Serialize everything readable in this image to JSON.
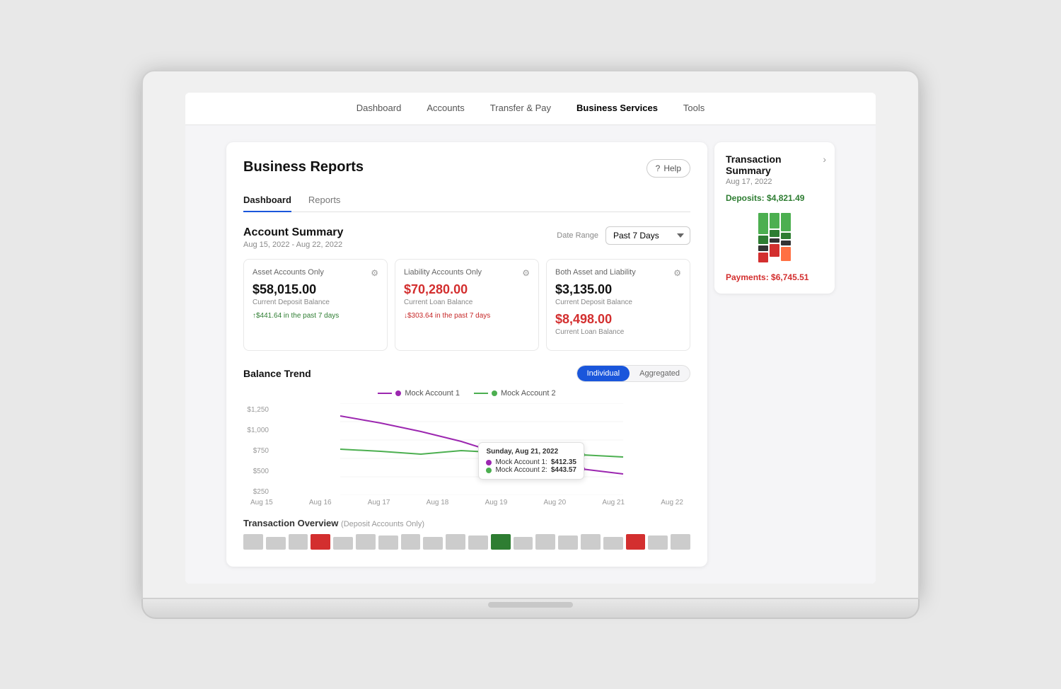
{
  "nav": {
    "items": [
      {
        "id": "dashboard",
        "label": "Dashboard",
        "active": false
      },
      {
        "id": "accounts",
        "label": "Accounts",
        "active": false
      },
      {
        "id": "transfer-pay",
        "label": "Transfer & Pay",
        "active": false
      },
      {
        "id": "business-services",
        "label": "Business Services",
        "active": true
      },
      {
        "id": "tools",
        "label": "Tools",
        "active": false
      }
    ]
  },
  "page": {
    "title": "Business Reports",
    "help_label": "Help"
  },
  "tabs": [
    {
      "id": "dashboard",
      "label": "Dashboard",
      "active": true
    },
    {
      "id": "reports",
      "label": "Reports",
      "active": false
    }
  ],
  "account_summary": {
    "title": "Account Summary",
    "date_range_text": "Aug 15, 2022 - Aug 22, 2022",
    "date_range_label": "Date Range",
    "date_range_value": "Past 7 Days",
    "cards": [
      {
        "title": "Asset Accounts Only",
        "amount": "$58,015.00",
        "amount_red": false,
        "balance_label": "Current Deposit Balance",
        "change": "↑$441.64 in the past 7 days",
        "change_type": "up"
      },
      {
        "title": "Liability Accounts Only",
        "amount": "$70,280.00",
        "amount_red": true,
        "balance_label": "Current Loan Balance",
        "change": "↓$303.64 in the past 7 days",
        "change_type": "down"
      },
      {
        "title": "Both Asset and Liability",
        "amount": "$3,135.00",
        "amount_red": false,
        "balance_label": "Current Deposit Balance",
        "amount2": "$8,498.00",
        "amount2_red": true,
        "balance_label2": "Current Loan Balance",
        "change": "",
        "change_type": ""
      }
    ]
  },
  "balance_trend": {
    "title": "Balance Trend",
    "toggle": {
      "individual": "Individual",
      "aggregated": "Aggregated",
      "active": "individual"
    },
    "legend": [
      {
        "label": "Mock Account 1",
        "color": "#9c27b0"
      },
      {
        "label": "Mock Account 2",
        "color": "#4caf50"
      }
    ],
    "y_labels": [
      "$1,250",
      "$1,000",
      "$750",
      "$500",
      "$250"
    ],
    "x_labels": [
      "Aug 15",
      "Aug 16",
      "Aug 17",
      "Aug 18",
      "Aug 19",
      "Aug 20",
      "Aug 21",
      "Aug 22"
    ],
    "tooltip": {
      "date": "Sunday, Aug 21, 2022",
      "account1_label": "Mock Account 1:",
      "account1_value": "$412.35",
      "account2_label": "Mock Account 2:",
      "account2_value": "$443.57"
    }
  },
  "transaction_overview": {
    "title": "Transaction Overview",
    "subtitle": "(Deposit Accounts Only)"
  },
  "transaction_summary": {
    "title": "Transaction Summary",
    "date": "Aug 17, 2022",
    "deposits_label": "Deposits:",
    "deposits_value": "$4,821.49",
    "payments_label": "Payments:",
    "payments_value": "$6,745.51"
  },
  "icons": {
    "gear": "⚙",
    "help_circle": "⓪",
    "chevron_right": "›"
  }
}
